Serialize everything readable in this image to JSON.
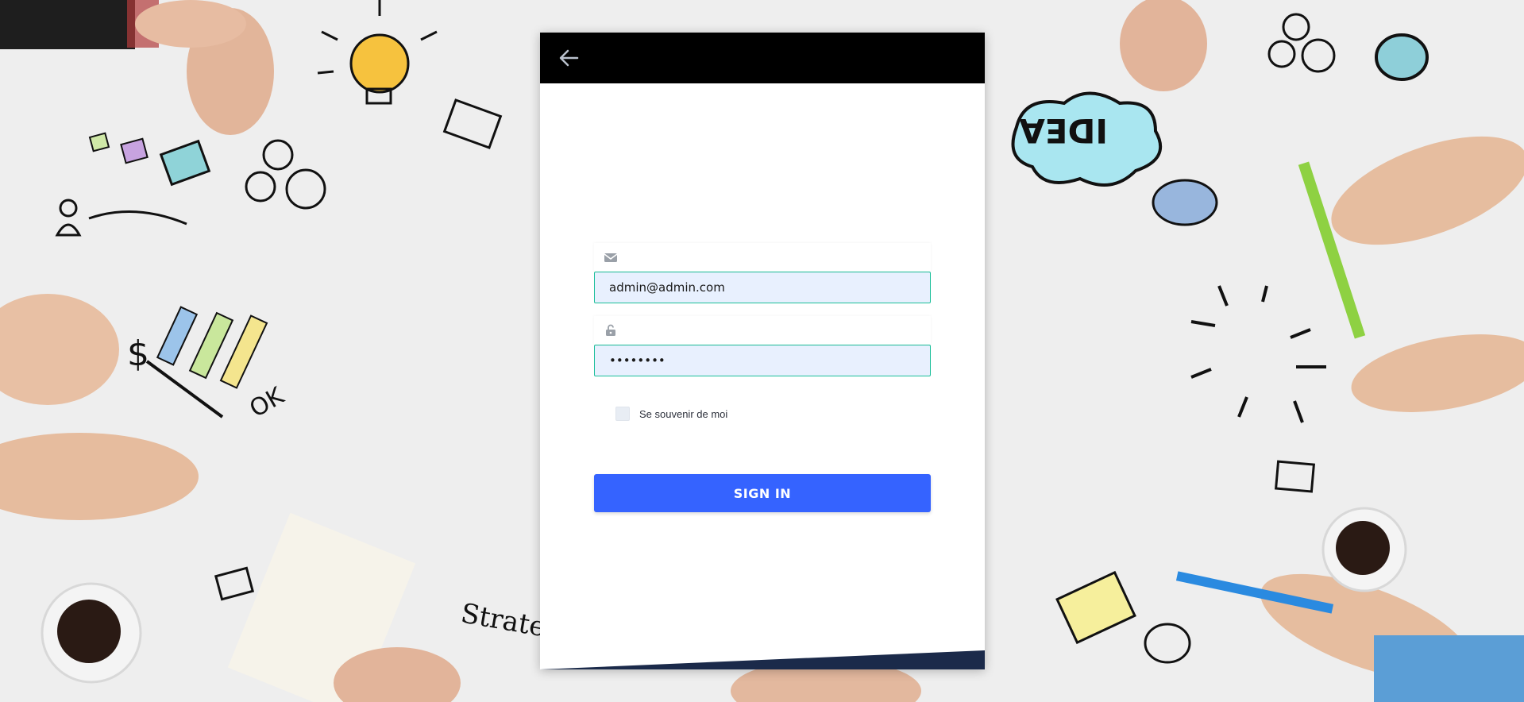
{
  "header": {
    "back_icon": "arrow-left-icon"
  },
  "form": {
    "email_icon": "envelope-icon",
    "email_value": "admin@admin.com",
    "password_icon": "unlock-icon",
    "password_value": "password",
    "remember_label": "Se souvenir de moi",
    "remember_checked": false,
    "signin_label": "SIGN IN"
  },
  "colors": {
    "header": "#000000",
    "accent_button": "#3563ff",
    "input_border": "#1bbf9a",
    "input_bg": "#e8f0fe",
    "footer_stripe": "#1b2a4a"
  }
}
